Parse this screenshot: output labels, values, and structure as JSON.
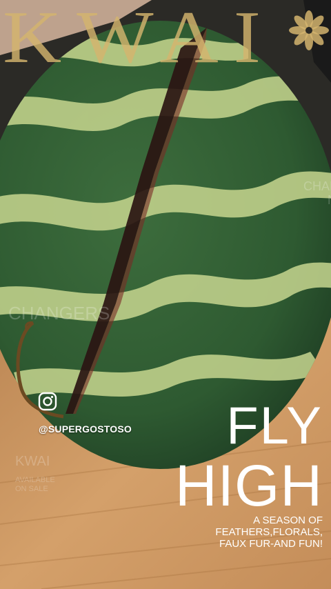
{
  "overlay": {
    "brand": "KWAI",
    "social_handle": "@SUPERGOSTOSO",
    "headline_line1": "FLY",
    "headline_line2": "HIGH",
    "tagline_lines": [
      "A SEASON OF",
      "FEATHERS,FLORALS,",
      "FAUX FUR-AND FUN!"
    ],
    "ghost_texts": [
      "CHANGERS",
      "CHANGERS",
      "NEWER",
      "KWAI",
      "AVAILABLE",
      "ON SALE"
    ]
  },
  "icons": [
    "instagram-icon",
    "flower-icon"
  ],
  "colors": {
    "brand": "#d4b46e",
    "rind_dark": "#2f5a33",
    "rind_light": "#c9d98e",
    "board": "#c9935c"
  }
}
